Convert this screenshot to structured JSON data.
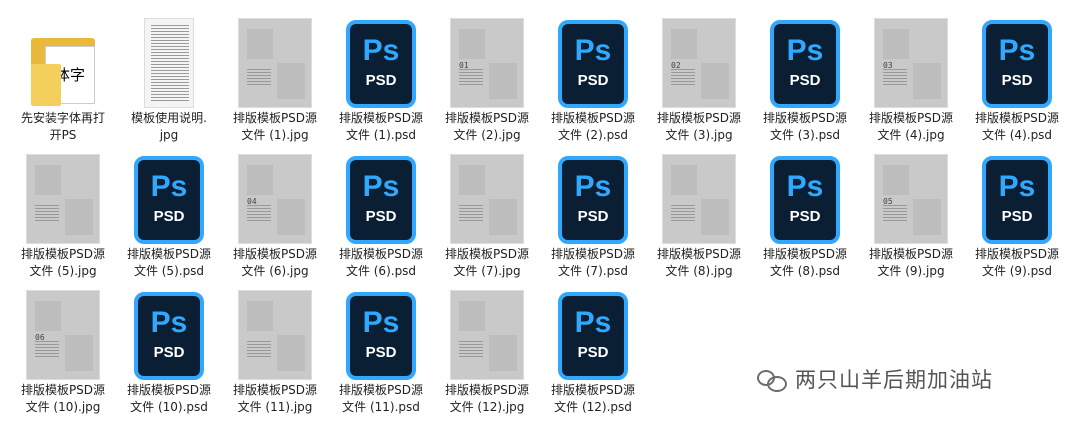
{
  "files": [
    {
      "name": "先安装字体再打\n开PS",
      "type": "folder"
    },
    {
      "name": "模板使用说明.\njpg",
      "type": "jpg-guide"
    },
    {
      "name": "排版模板PSD源\n文件 (1).jpg",
      "type": "jpg"
    },
    {
      "name": "排版模板PSD源\n文件 (1).psd",
      "type": "psd"
    },
    {
      "name": "排版模板PSD源\n文件 (2).jpg",
      "type": "jpg",
      "num": "01"
    },
    {
      "name": "排版模板PSD源\n文件 (2).psd",
      "type": "psd"
    },
    {
      "name": "排版模板PSD源\n文件 (3).jpg",
      "type": "jpg",
      "num": "02"
    },
    {
      "name": "排版模板PSD源\n文件 (3).psd",
      "type": "psd"
    },
    {
      "name": "排版模板PSD源\n文件 (4).jpg",
      "type": "jpg",
      "num": "03"
    },
    {
      "name": "排版模板PSD源\n文件 (4).psd",
      "type": "psd"
    },
    {
      "name": "排版模板PSD源\n文件 (5).jpg",
      "type": "jpg"
    },
    {
      "name": "排版模板PSD源\n文件 (5).psd",
      "type": "psd"
    },
    {
      "name": "排版模板PSD源\n文件 (6).jpg",
      "type": "jpg",
      "num": "04"
    },
    {
      "name": "排版模板PSD源\n文件 (6).psd",
      "type": "psd"
    },
    {
      "name": "排版模板PSD源\n文件 (7).jpg",
      "type": "jpg"
    },
    {
      "name": "排版模板PSD源\n文件 (7).psd",
      "type": "psd"
    },
    {
      "name": "排版模板PSD源\n文件 (8).jpg",
      "type": "jpg"
    },
    {
      "name": "排版模板PSD源\n文件 (8).psd",
      "type": "psd"
    },
    {
      "name": "排版模板PSD源\n文件 (9).jpg",
      "type": "jpg",
      "num": "05"
    },
    {
      "name": "排版模板PSD源\n文件 (9).psd",
      "type": "psd"
    },
    {
      "name": "排版模板PSD源\n文件 (10).jpg",
      "type": "jpg",
      "num": "06"
    },
    {
      "name": "排版模板PSD源\n文件 (10).psd",
      "type": "psd"
    },
    {
      "name": "排版模板PSD源\n文件 (11).jpg",
      "type": "jpg"
    },
    {
      "name": "排版模板PSD源\n文件 (11).psd",
      "type": "psd"
    },
    {
      "name": "排版模板PSD源\n文件 (12).jpg",
      "type": "jpg"
    },
    {
      "name": "排版模板PSD源\n文件 (12).psd",
      "type": "psd"
    }
  ],
  "ps_icon": {
    "title": "Ps",
    "subtitle": "PSD"
  },
  "folder_icon_text": "体字",
  "watermark": "两只山羊后期加油站",
  "colors": {
    "ps_blue": "#31a8ff",
    "ps_bg": "#0a1f33",
    "folder": "#e8b93b"
  }
}
